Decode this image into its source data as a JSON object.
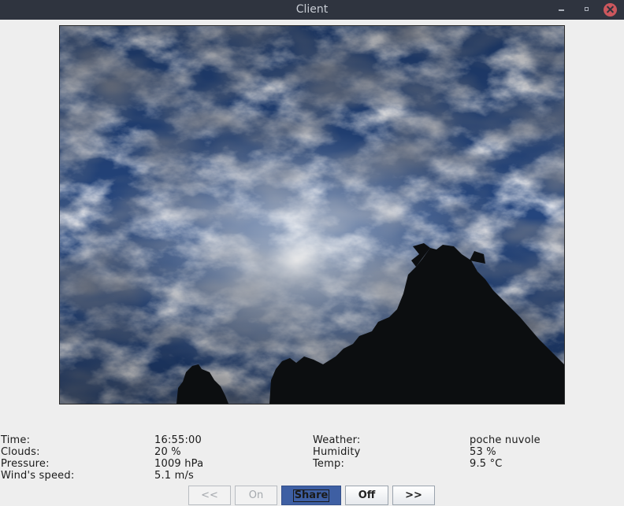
{
  "window": {
    "title": "Client"
  },
  "info": {
    "rows": [
      {
        "label": "Time:",
        "value": "16:55:00",
        "label2": "Weather:",
        "value2": "poche nuvole"
      },
      {
        "label": "Clouds:",
        "value": "20 %",
        "label2": "Humidity",
        "value2": "53 %"
      },
      {
        "label": "Pressure:",
        "value": "1009 hPa",
        "label2": "Temp:",
        "value2": "9.5 °C"
      },
      {
        "label": "Wind's speed:",
        "value": "5.1 m/s"
      }
    ]
  },
  "buttons": {
    "prev": "<<",
    "on": "On",
    "share": "Share",
    "off": "Off",
    "next": ">>"
  },
  "colors": {
    "titlebar": "#2f343f",
    "close_button": "#cc575d",
    "share_button": "#3e5fa3",
    "sky": "#24457d"
  }
}
